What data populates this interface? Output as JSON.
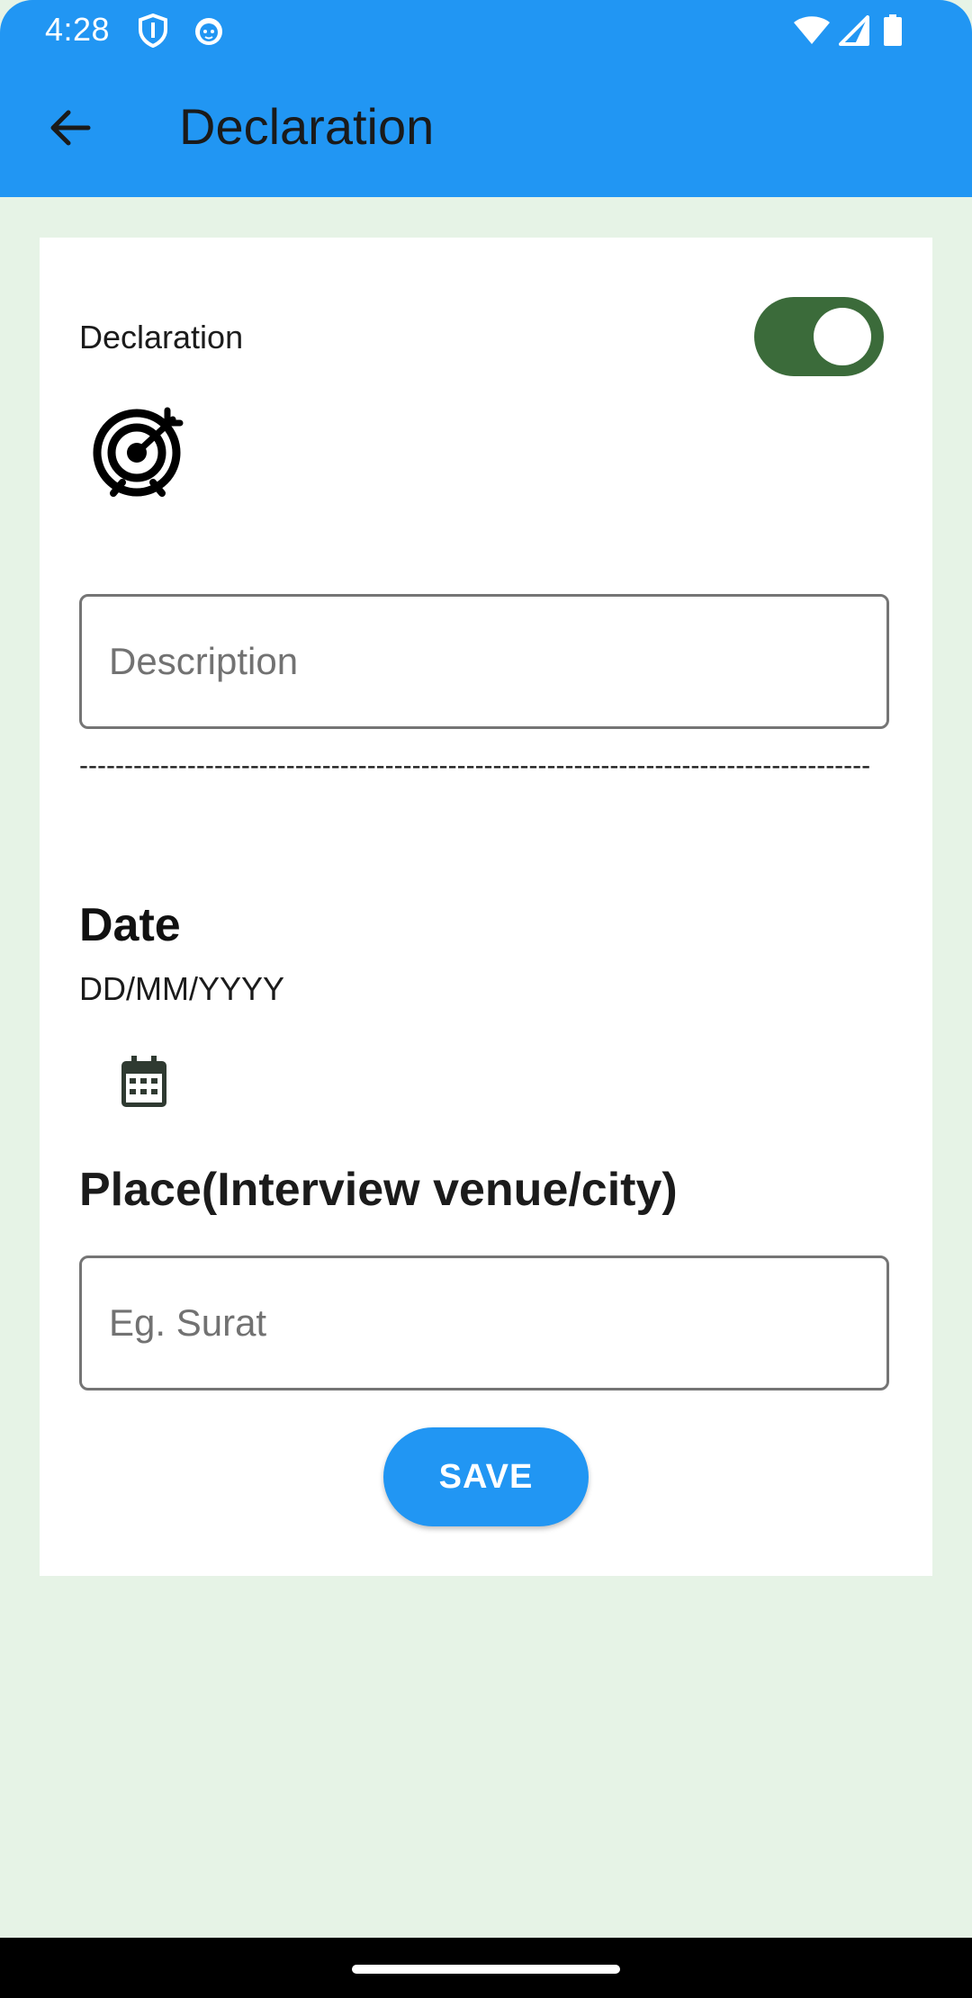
{
  "status_bar": {
    "time": "4:28",
    "icons": [
      "shield-icon",
      "cat-icon",
      "wifi-icon",
      "signal-icon",
      "battery-icon"
    ]
  },
  "app_bar": {
    "title": "Declaration",
    "back_icon": "arrow-back-icon",
    "background": "#2196F3"
  },
  "form": {
    "declaration_label": "Declaration",
    "declaration_toggle_on": true,
    "toggle_color": "#3B6B3A",
    "target_icon": "target-icon",
    "description_placeholder": "Description",
    "description_value": "",
    "separator": "----------------------------------------------------------------------------------------",
    "date_heading": "Date",
    "date_format": "DD/MM/YYYY",
    "calendar_icon": "calendar-icon",
    "place_heading": "Place(Interview venue/city)",
    "place_placeholder": "Eg. Surat",
    "place_value": "",
    "save_label": "SAVE",
    "save_color": "#2196F3"
  },
  "background_color": "#E6F3E6"
}
